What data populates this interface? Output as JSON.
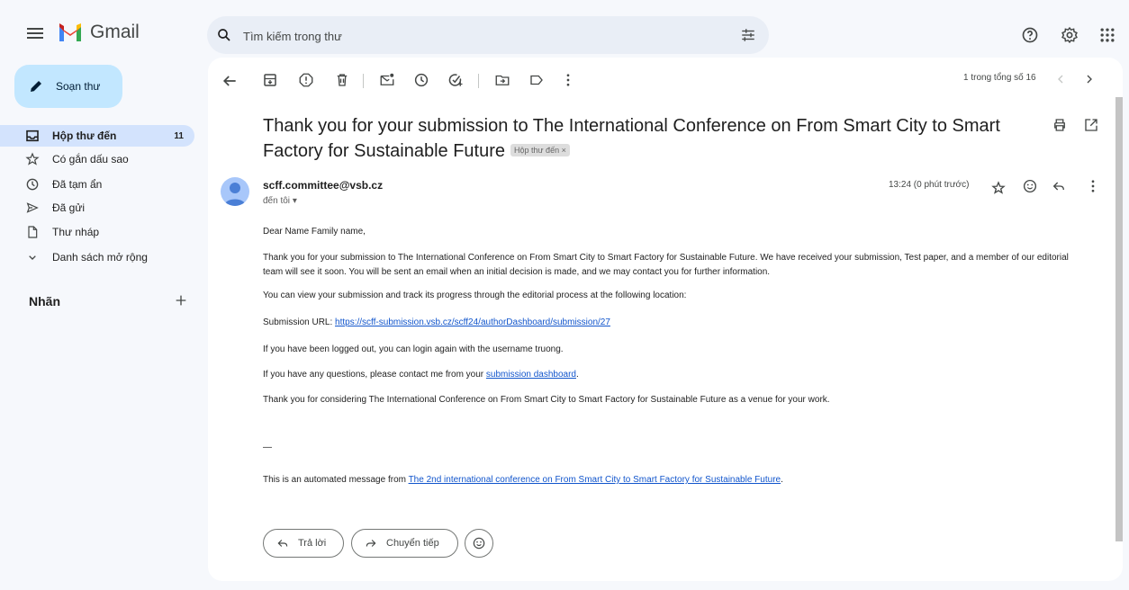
{
  "app": {
    "name": "Gmail"
  },
  "search": {
    "placeholder": "Tìm kiếm trong thư"
  },
  "sidebar": {
    "compose_label": "Soạn thư",
    "items": [
      {
        "label": "Hộp thư đến",
        "count": "11",
        "icon": "inbox-icon"
      },
      {
        "label": "Có gắn dấu sao",
        "icon": "star-icon"
      },
      {
        "label": "Đã tạm ẩn",
        "icon": "clock-icon"
      },
      {
        "label": "Đã gửi",
        "icon": "send-icon"
      },
      {
        "label": "Thư nháp",
        "icon": "draft-icon"
      },
      {
        "label": "Danh sách mở rộng",
        "icon": "chevron-down-icon"
      }
    ],
    "labels_title": "Nhãn"
  },
  "toolbar": {
    "page_info": "1 trong tổng số 16"
  },
  "message": {
    "subject": "Thank you for your submission to The International Conference on From Smart City to Smart Factory for Sustainable Future",
    "label_chip": "Hộp thư đến",
    "label_chip_close": "×",
    "sender": "scff.committee@vsb.cz",
    "to": "đến tôi",
    "time": "13:24 (0 phút trước)",
    "body": {
      "greeting": "Dear Name Family name,",
      "p1": "Thank you for your submission to The International Conference on From Smart City to Smart Factory for Sustainable Future. We have received your submission, Test paper, and a member of our editorial team will see it soon. You will be sent an email when an initial decision is made, and we may contact you for further information.",
      "p2": "You can view your submission and track its progress through the editorial process at the following location:",
      "url_prefix": "Submission URL: ",
      "url": "https://scff-submission.vsb.cz/scff24/authorDashboard/submission/27",
      "p3": "If you have been logged out, you can login again with the username truong.",
      "p4_prefix": "If you have any questions, please contact me from your ",
      "p4_link": "submission dashboard",
      "p4_suffix": ".",
      "p5": "Thank you for considering The International Conference on From Smart City to Smart Factory for Sustainable Future as a venue for your work.",
      "signature_dash": "—",
      "footer_prefix": "This is an automated message from ",
      "footer_link": "The 2nd international conference on From Smart City to Smart Factory for Sustainable Future",
      "footer_suffix": "."
    }
  },
  "actions": {
    "reply": "Trả lời",
    "forward": "Chuyển tiếp"
  },
  "colors": {
    "compose_bg": "#c2e7ff",
    "active_nav_bg": "#d3e3fd",
    "link": "#1155cc",
    "page_bg": "#f6f8fc"
  }
}
